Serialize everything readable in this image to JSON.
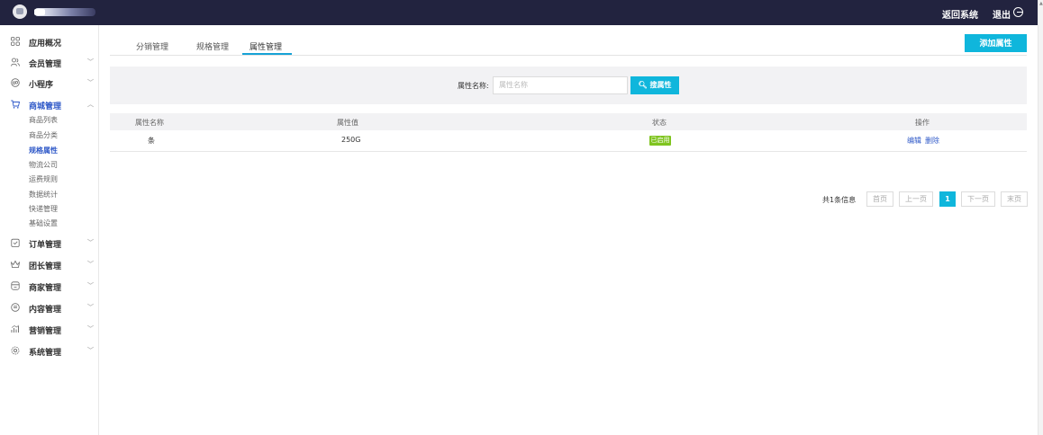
{
  "topbar": {
    "back_label": "返回系统",
    "exit_label": "退出"
  },
  "sidebar": {
    "items": [
      {
        "label": "应用概况",
        "icon": "grid-icon",
        "has_arrow": false
      },
      {
        "label": "会员管理",
        "icon": "users-icon",
        "has_arrow": true
      },
      {
        "label": "小程序",
        "icon": "miniprogram-icon",
        "has_arrow": true
      },
      {
        "label": "商城管理",
        "icon": "cart-icon",
        "has_arrow": true,
        "expanded": true
      },
      {
        "label": "订单管理",
        "icon": "order-icon",
        "has_arrow": true
      },
      {
        "label": "团长管理",
        "icon": "crown-icon",
        "has_arrow": true
      },
      {
        "label": "商家管理",
        "icon": "shop-icon",
        "has_arrow": true
      },
      {
        "label": "内容管理",
        "icon": "document-icon",
        "has_arrow": true
      },
      {
        "label": "营销管理",
        "icon": "chart-icon",
        "has_arrow": true
      },
      {
        "label": "系统管理",
        "icon": "gear-icon",
        "has_arrow": true
      }
    ],
    "sub_items": [
      "商品列表",
      "商品分类",
      "规格属性",
      "物流公司",
      "运费规则",
      "数据统计",
      "快递管理",
      "基础设置"
    ],
    "active_sub": "规格属性"
  },
  "tabs": [
    "分销管理",
    "规格管理",
    "属性管理"
  ],
  "active_tab": "属性管理",
  "add_button": "添加属性",
  "search": {
    "label": "属性名称:",
    "placeholder": "属性名称",
    "button": "搜属性"
  },
  "table": {
    "headers": [
      "属性名称",
      "属性值",
      "状态",
      "操作"
    ],
    "rows": [
      {
        "name": "条",
        "value": "250G",
        "status": "已启用",
        "actions": [
          "编辑",
          "删除"
        ]
      }
    ]
  },
  "pager": {
    "info": "共1条信息",
    "first": "首页",
    "prev": "上一页",
    "current": "1",
    "next": "下一页",
    "last": "末页"
  },
  "colors": {
    "topbar": "#22233f",
    "accent": "#0fb6dc",
    "active_menu": "#2f59c8",
    "status_enabled": "#7fc41f"
  }
}
